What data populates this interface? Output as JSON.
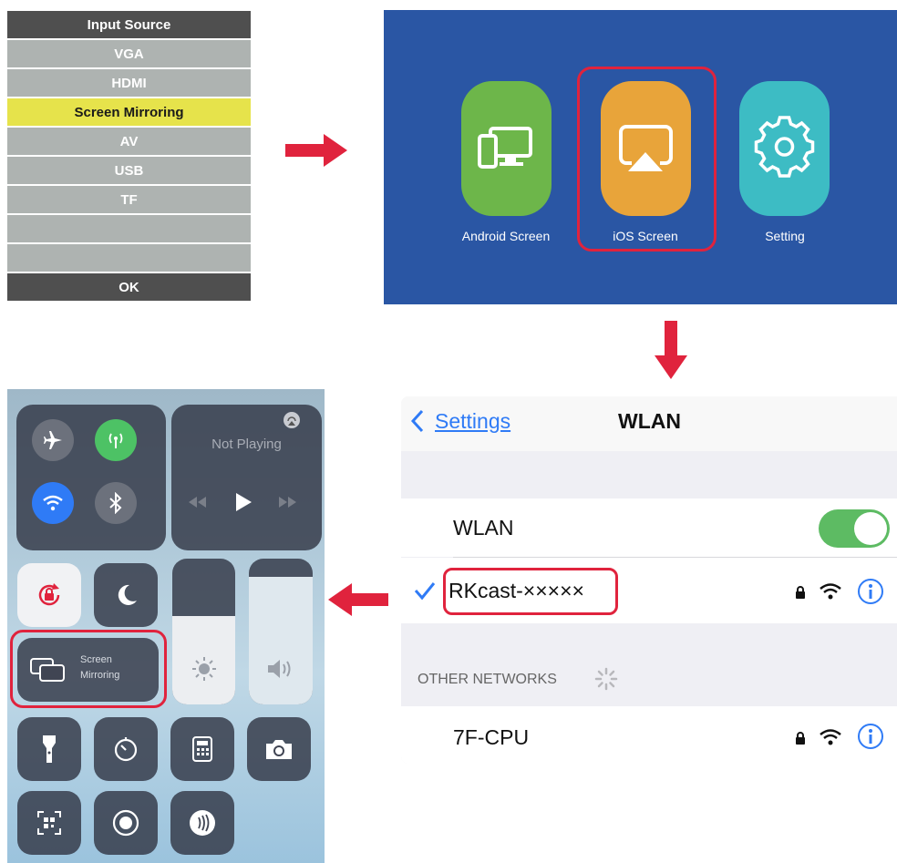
{
  "input_source": {
    "title": "Input Source",
    "items": [
      "VGA",
      "HDMI",
      "Screen Mirroring",
      "AV",
      "USB",
      "TF",
      "",
      ""
    ],
    "selected": "Screen Mirroring",
    "ok_label": "OK"
  },
  "home_screen": {
    "apps": [
      {
        "label": "Android Screen",
        "icon": "devices-icon",
        "color": "#6db64a"
      },
      {
        "label": "iOS Screen",
        "icon": "airplay-icon",
        "color": "#e8a43a"
      },
      {
        "label": "Setting",
        "icon": "gear-icon",
        "color": "#3dbcc4"
      }
    ],
    "highlighted": "iOS Screen"
  },
  "wlan_settings": {
    "back_label": "Settings",
    "title": "WLAN",
    "wlan_label": "WLAN",
    "wlan_on": true,
    "connected_network": "RKcast-×××××",
    "other_networks_header": "OTHER NETWORKS",
    "other_network": "7F-CPU"
  },
  "control_center": {
    "now_playing": "Not Playing",
    "screen_mirroring_label_line1": "Screen",
    "screen_mirroring_label_line2": "Mirroring"
  },
  "colors": {
    "highlight_red": "#e0233d",
    "ios_blue": "#2f7bf6",
    "toggle_green": "#5dbb63"
  }
}
